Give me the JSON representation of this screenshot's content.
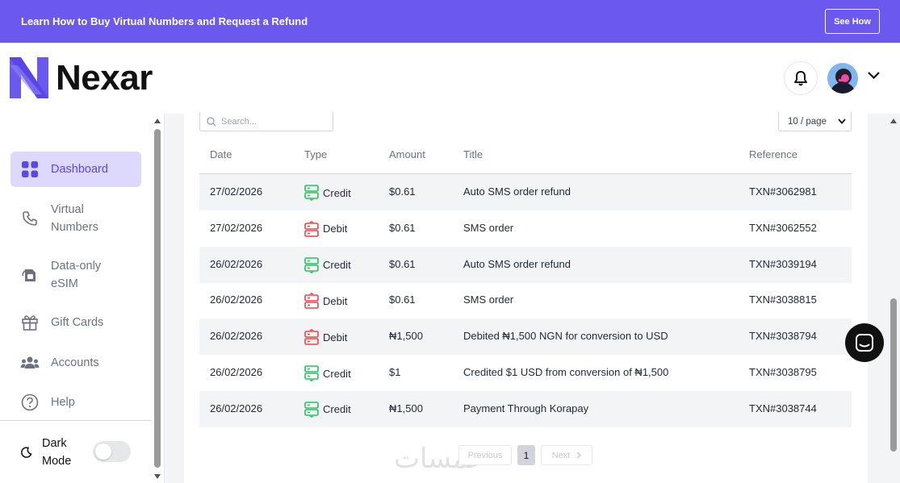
{
  "banner": {
    "text": "Learn How to Buy Virtual Numbers and Request a Refund",
    "button": "See How"
  },
  "brand": {
    "name": "Nexar",
    "accent": "#6b58ee"
  },
  "sidebar": {
    "items": [
      {
        "label": "Dashboard",
        "icon": "grid-icon",
        "active": true
      },
      {
        "label_line1": "Virtual",
        "label_line2": "Numbers",
        "icon": "phone-icon"
      },
      {
        "label_line1": "Data-only",
        "label_line2": "eSIM",
        "icon": "sim-icon"
      },
      {
        "label": "Gift Cards",
        "icon": "gift-icon"
      },
      {
        "label": "Accounts",
        "icon": "users-icon"
      },
      {
        "label": "Help",
        "icon": "help-icon"
      }
    ],
    "dark_mode": {
      "line1": "Dark",
      "line2": "Mode",
      "enabled": false
    }
  },
  "table": {
    "search_placeholder": "Search...",
    "page_size": "10 / page",
    "columns": [
      "Date",
      "Type",
      "Amount",
      "Title",
      "Reference"
    ],
    "rows": [
      {
        "date": "27/02/2026",
        "type": "Credit",
        "amount": "$0.61",
        "title": "Auto SMS order refund",
        "reference": "TXN#3062981"
      },
      {
        "date": "27/02/2026",
        "type": "Debit",
        "amount": "$0.61",
        "title": "SMS order",
        "reference": "TXN#3062552"
      },
      {
        "date": "26/02/2026",
        "type": "Credit",
        "amount": "$0.61",
        "title": "Auto SMS order refund",
        "reference": "TXN#3039194"
      },
      {
        "date": "26/02/2026",
        "type": "Debit",
        "amount": "$0.61",
        "title": "SMS order",
        "reference": "TXN#3038815"
      },
      {
        "date": "26/02/2026",
        "type": "Debit",
        "amount": "₦1,500",
        "title": "Debited ₦1,500 NGN for conversion to USD",
        "reference": "TXN#3038794"
      },
      {
        "date": "26/02/2026",
        "type": "Credit",
        "amount": "$1",
        "title": "Credited $1 USD from conversion of ₦1,500",
        "reference": "TXN#3038795"
      },
      {
        "date": "26/02/2026",
        "type": "Credit",
        "amount": "₦1,500",
        "title": "Payment Through Korapay",
        "reference": "TXN#3038744"
      }
    ]
  },
  "pagination": {
    "previous": "Previous",
    "current": "1",
    "next": "Next"
  },
  "watermark": "خمسات",
  "colors": {
    "credit": "#22c55e",
    "debit": "#ef4444",
    "active_bg": "#ddd9fc"
  }
}
